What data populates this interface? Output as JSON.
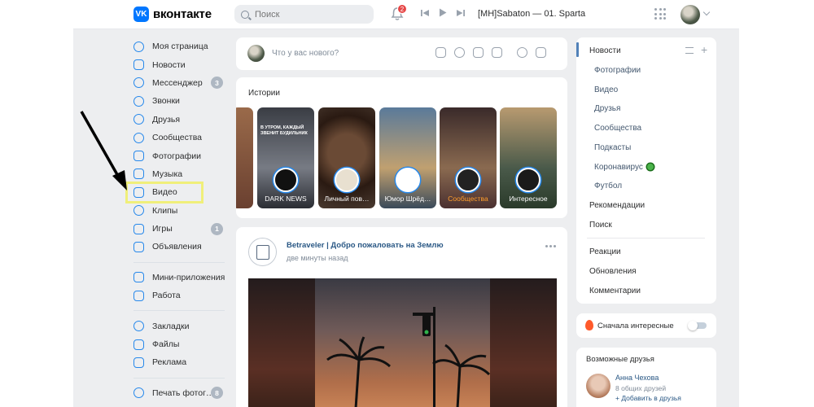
{
  "header": {
    "brand": "вконтакте",
    "brand_badge": "VK",
    "search_placeholder": "Поиск",
    "notifications_count": "2",
    "track": "[MH]Sabaton — 01. Sparta",
    "player_prev_icon": "skip-back-icon",
    "player_play_icon": "play-icon",
    "player_next_icon": "skip-forward-icon"
  },
  "nav": {
    "items": [
      {
        "label": "Моя страница",
        "icon": "profile-icon"
      },
      {
        "label": "Новости",
        "icon": "news-icon"
      },
      {
        "label": "Мессенджер",
        "icon": "messenger-icon",
        "count": "3"
      },
      {
        "label": "Звонки",
        "icon": "phone-icon"
      },
      {
        "label": "Друзья",
        "icon": "friends-icon"
      },
      {
        "label": "Сообщества",
        "icon": "communities-icon"
      },
      {
        "label": "Фотографии",
        "icon": "photos-icon"
      },
      {
        "label": "Музыка",
        "icon": "music-icon"
      },
      {
        "label": "Видео",
        "icon": "video-icon"
      },
      {
        "label": "Клипы",
        "icon": "clips-icon"
      },
      {
        "label": "Игры",
        "icon": "games-icon",
        "count": "1"
      },
      {
        "label": "Объявления",
        "icon": "classifieds-icon"
      }
    ],
    "items2": [
      {
        "label": "Мини-приложения",
        "icon": "apps-icon"
      },
      {
        "label": "Работа",
        "icon": "work-icon"
      }
    ],
    "items3": [
      {
        "label": "Закладки",
        "icon": "bookmarks-icon"
      },
      {
        "label": "Файлы",
        "icon": "files-icon"
      },
      {
        "label": "Реклама",
        "icon": "ads-icon"
      }
    ],
    "items4": [
      {
        "label": "Печать фотог…",
        "icon": "print-icon",
        "count": "8"
      }
    ]
  },
  "composer": {
    "placeholder": "Что у вас нового?"
  },
  "stories": {
    "title": "Истории",
    "items": [
      {
        "label": "DARK NEWS",
        "banner": "В УТРОМ, КАЖДЫЙ ЗВЕНИТ БУДИЛЬНИК",
        "colors": [
          "#2b2e33",
          "#6b6f78"
        ]
      },
      {
        "label": "Личный пов…",
        "colors": [
          "#3a2a20",
          "#8a6a4a"
        ]
      },
      {
        "label": "Юмор Шрёд…",
        "colors": [
          "#35506e",
          "#c1a27a"
        ]
      },
      {
        "label": "Сообщества",
        "colors": [
          "#5a3a3a",
          "#b89060"
        ],
        "highlight": true
      },
      {
        "label": "Интересное",
        "colors": [
          "#3a3f3a",
          "#7a8a7a"
        ]
      }
    ]
  },
  "post": {
    "author": "Betraveler | Добро пожаловать на Землю",
    "time": "две минуты назад"
  },
  "right_menu": {
    "active": "Новости",
    "sub": [
      "Фотографии",
      "Видео",
      "Друзья",
      "Сообщества",
      "Подкасты",
      "Коронавирус",
      "Футбол"
    ],
    "top": [
      "Рекомендации",
      "Поиск"
    ],
    "bottom": [
      "Реакции",
      "Обновления",
      "Комментарии"
    ]
  },
  "interesting": {
    "label": "Сначала интересные",
    "enabled": false
  },
  "friends": {
    "title": "Возможные друзья",
    "name": "Анна Чехова",
    "mutual": "8 общих друзей",
    "add": "+ Добавить в друзья"
  },
  "colors": {
    "accent": "#2688eb",
    "brand": "#0077ff",
    "link": "#2a5885",
    "highlight_box": "#f0ef7a"
  }
}
